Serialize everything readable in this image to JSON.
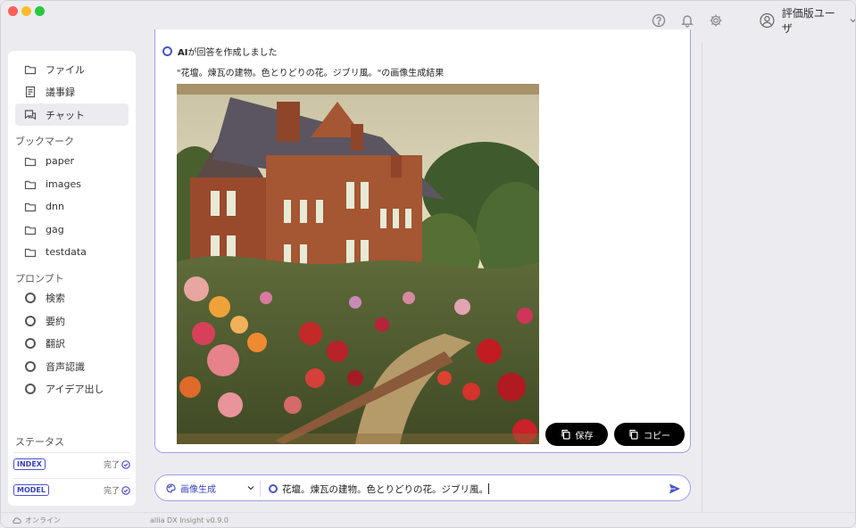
{
  "header": {
    "user_name": "評価版ユーザ",
    "icons": [
      "help-icon",
      "bell-icon",
      "gear-icon",
      "avatar-icon"
    ]
  },
  "sidebar": {
    "top_items": [
      {
        "label": "ファイル",
        "icon": "folder-icon"
      },
      {
        "label": "議事録",
        "icon": "document-icon"
      },
      {
        "label": "チャット",
        "icon": "chat-icon",
        "active": true
      }
    ],
    "bookmarks_heading": "ブックマーク",
    "bookmarks": [
      {
        "label": "paper"
      },
      {
        "label": "images"
      },
      {
        "label": "dnn"
      },
      {
        "label": "gag"
      },
      {
        "label": "testdata"
      }
    ],
    "prompts_heading": "プロンプト",
    "prompts": [
      {
        "label": "検索"
      },
      {
        "label": "要約"
      },
      {
        "label": "翻訳"
      },
      {
        "label": "音声認識"
      },
      {
        "label": "アイデア出し"
      }
    ],
    "status_heading": "ステータス",
    "status": [
      {
        "badge": "INDEX",
        "state": "完了"
      },
      {
        "badge": "MODEL",
        "state": "完了"
      }
    ]
  },
  "chat": {
    "ai_label": "AI",
    "ai_message": "が回答を作成しました",
    "prompt_echo": "\"花壇。煉瓦の建物。色とりどりの花。ジブリ風。\"の画像生成結果",
    "save_label": "保存",
    "copy_label": "コピー"
  },
  "input": {
    "mode_label": "画像生成",
    "text": "花壇。煉瓦の建物。色とりどりの花。ジブリ風。"
  },
  "footer": {
    "online_label": "オンライン",
    "version": "allia DX Insight v0.9.0"
  },
  "colors": {
    "accent": "#4b52c8",
    "window_bg": "#ececf0"
  }
}
